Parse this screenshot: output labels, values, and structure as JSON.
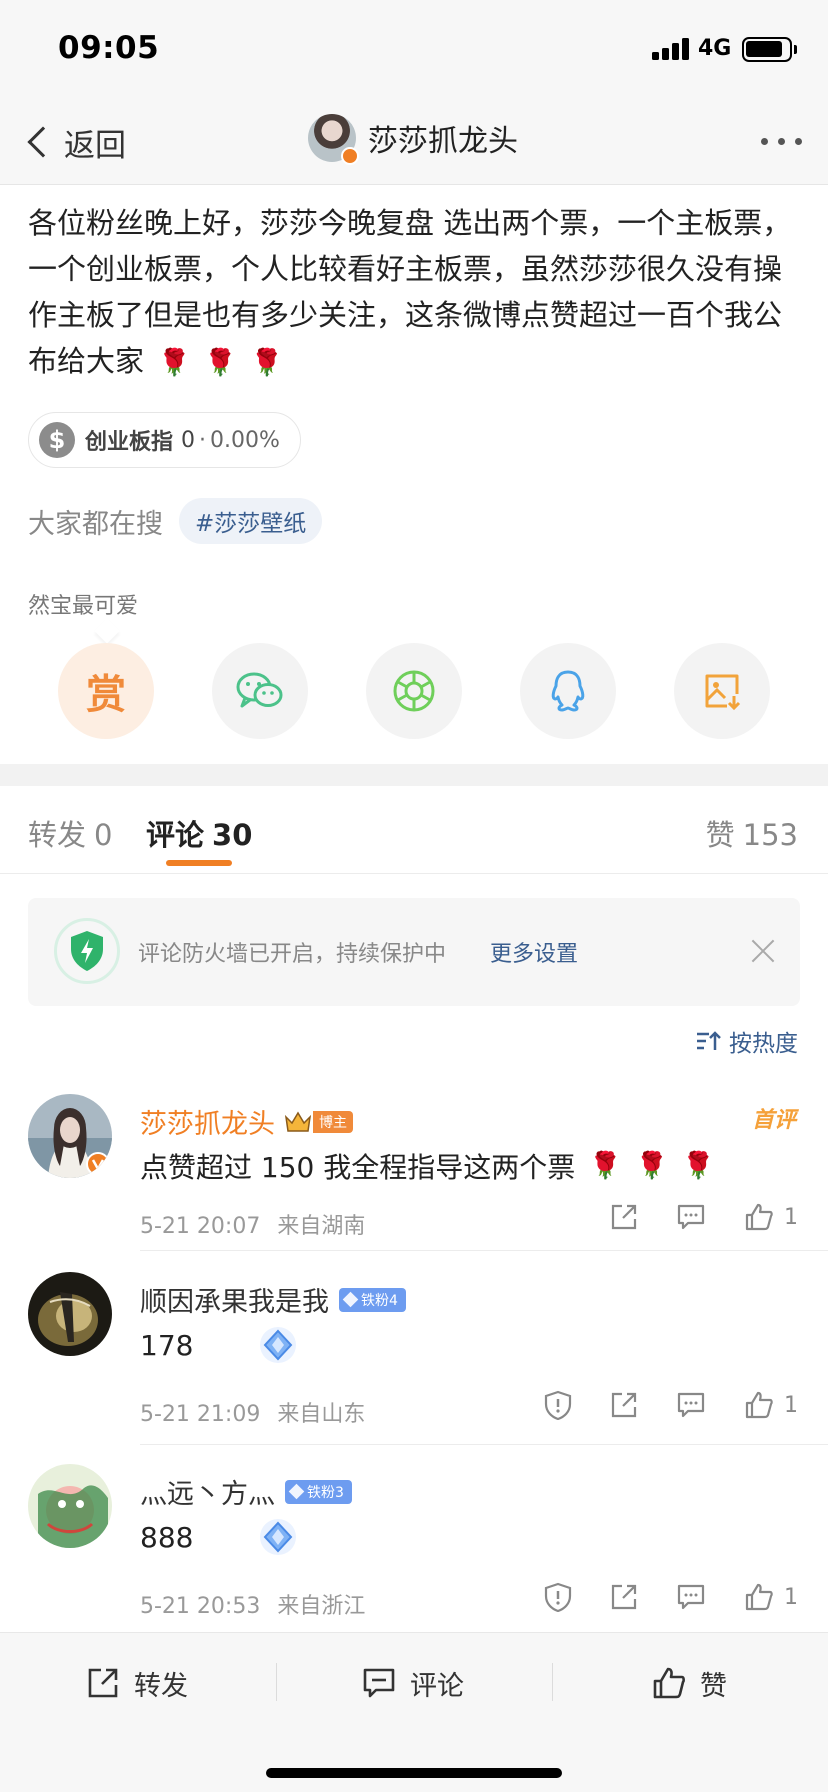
{
  "status": {
    "time": "09:05",
    "network": "4G"
  },
  "nav": {
    "back_label": "返回",
    "title": "莎莎抓龙头"
  },
  "post": {
    "text": "各位粉丝晚上好，莎莎今晚复盘 选出两个票，一个主板票，一个创业板票，个人比较看好主板票，虽然莎莎很久没有操作主板了但是也有多少关注，这条微博点赞超过一百个我公布给大家",
    "roses": [
      "🌹",
      "🌹",
      "🌹"
    ],
    "stock": {
      "name": "创业板指",
      "value": "0",
      "separator": "·",
      "change": "0.00%"
    },
    "search": {
      "label": "大家都在搜",
      "tag": "#莎莎壁纸"
    },
    "tip": "然宝最可爱",
    "reward_label": "赏"
  },
  "tabs": {
    "repost": {
      "label": "转发",
      "count": "0"
    },
    "comment": {
      "label": "评论",
      "count": "30"
    },
    "like": {
      "label": "赞",
      "count": "153"
    }
  },
  "firewall": {
    "text": "评论防火墙已开启，持续保护中",
    "link": "更多设置"
  },
  "sort_label": "按热度",
  "comments": [
    {
      "name": "莎莎抓龙头",
      "badge": "博主",
      "first_label": "首评",
      "text": "点赞超过 150 我全程指导这两个票",
      "time": "5-21 20:07",
      "location": "来自湖南",
      "likes": "1"
    },
    {
      "name": "顺因承果我是我",
      "badge": "铁粉4",
      "text": "178",
      "time": "5-21 21:09",
      "location": "来自山东",
      "likes": "1"
    },
    {
      "name": "灬远丶方灬",
      "badge": "铁粉3",
      "text": "888",
      "time": "5-21 20:53",
      "location": "来自浙江",
      "likes": "1"
    }
  ],
  "bottom": {
    "repost": "转发",
    "comment": "评论",
    "like": "赞"
  },
  "colors": {
    "accent": "#f07f24",
    "link": "#3a5e8f",
    "green": "#2fb36b"
  }
}
